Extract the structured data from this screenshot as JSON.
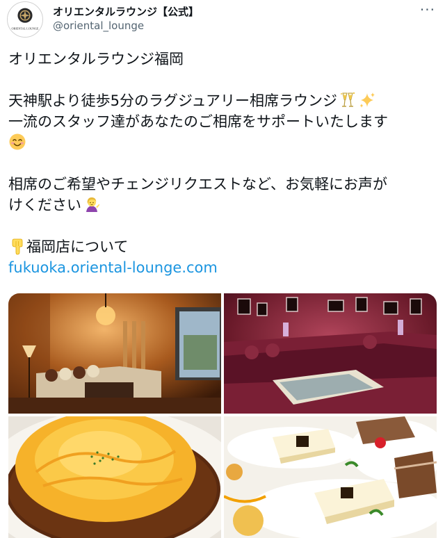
{
  "account": {
    "display_name": "オリエンタルラウンジ【公式】",
    "handle": "@oriental_lounge",
    "avatar_text": "ORIENTAL LOUNGE",
    "more_label": "···"
  },
  "tweet": {
    "line1": "オリエンタルラウンジ福岡",
    "line2": "天神駅より徒歩5分のラグジュアリー相席ラウンジ",
    "line3": "一流のスタッフ達があなたのご相席をサポートいたします",
    "line4": "相席のご希望やチェンジリクエストなど、お気軽にお声が",
    "line5": "けください",
    "line6": "福岡店について",
    "link": "fukuoka.oriental-lounge.com"
  },
  "emoji": {
    "after_line2": [
      "champagne-glasses-icon",
      "sparkles-icon"
    ],
    "after_line3": "smiling-face-icon",
    "after_line5": "person-tipping-hand-icon",
    "before_line6": "backhand-index-pointing-down-icon"
  },
  "media": {
    "photos": [
      "lounge-sofa-photo",
      "red-room-photo",
      "omelette-rice-photo",
      "cheesecake-dessert-photo"
    ]
  },
  "colors": {
    "link": "#1b95e0",
    "secondary_text": "#536471",
    "text": "#0f1419"
  }
}
